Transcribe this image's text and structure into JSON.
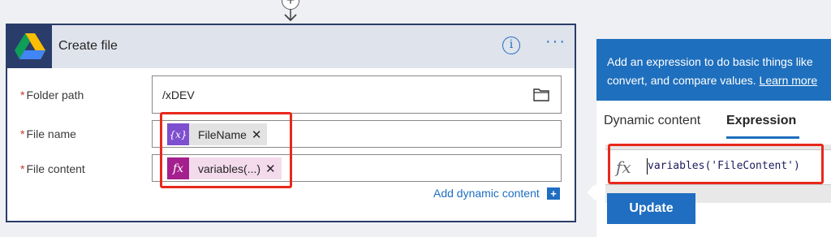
{
  "connector": {
    "add_symbol": "+"
  },
  "card": {
    "title": "Create file",
    "info_symbol": "i",
    "more_symbol": "···",
    "fields": {
      "folder_path": {
        "label": "Folder path",
        "required_mark": "*",
        "value": "/xDEV"
      },
      "file_name": {
        "label": "File name",
        "required_mark": "*",
        "token_icon": "{x}",
        "token_label": "FileName",
        "token_remove": "✕"
      },
      "file_content": {
        "label": "File content",
        "required_mark": "*",
        "token_icon": "fx",
        "token_label": "variables(...)",
        "token_remove": "✕"
      }
    },
    "add_dynamic": {
      "label": "Add dynamic content",
      "plus": "+"
    }
  },
  "panel": {
    "header_line1": "Add an expression to do basic things like",
    "header_line2_prefix": "convert, and compare values. ",
    "learn_more": "Learn more",
    "tabs": {
      "dynamic": "Dynamic content",
      "expression": "Expression"
    },
    "expression": {
      "fx_symbol": "fx",
      "value": "variables('FileContent')"
    },
    "update_label": "Update"
  },
  "colors": {
    "accent": "#1f6ec1",
    "card_border": "#2a3c6a",
    "highlight": "#e8281b",
    "variable_token": "#7e4fcf",
    "expression_token": "#a4208e",
    "panel_header": "#1e6fbd"
  },
  "icons": {
    "service": "google-drive-icon",
    "folder": "folder-icon",
    "info": "info-icon",
    "more": "more-options-icon"
  }
}
